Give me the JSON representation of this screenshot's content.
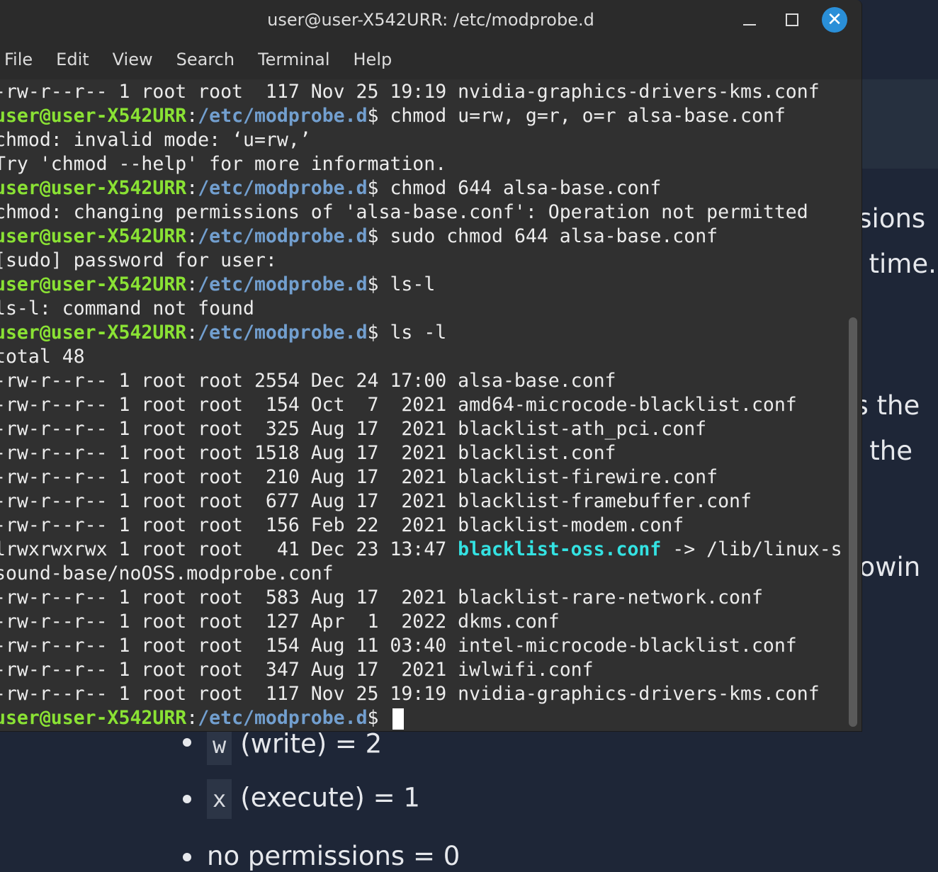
{
  "window": {
    "title": "user@user-X542URR: /etc/modprobe.d"
  },
  "menu": [
    "File",
    "Edit",
    "View",
    "Search",
    "Terminal",
    "Help"
  ],
  "prompt": {
    "user_host": "user@user-X542URR",
    "path": "/etc/modprobe.d",
    "symbol": "$ "
  },
  "terminal_lines": [
    "-rw-r--r-- 1 root root  117 Nov 25 19:19 nvidia-graphics-drivers-kms.conf",
    {
      "cmd": "chmod u=rw, g=r, o=r alsa-base.conf"
    },
    "chmod: invalid mode: ‘u=rw,’",
    "Try 'chmod --help' for more information.",
    {
      "cmd": "chmod 644 alsa-base.conf"
    },
    "chmod: changing permissions of 'alsa-base.conf': Operation not permitted",
    {
      "cmd": "sudo chmod 644 alsa-base.conf"
    },
    "[sudo] password for user:",
    {
      "cmd": "ls-l"
    },
    "ls-l: command not found",
    {
      "cmd": "ls -l"
    },
    "total 48",
    "-rw-r--r-- 1 root root 2554 Dec 24 17:00 alsa-base.conf",
    "-rw-r--r-- 1 root root  154 Oct  7  2021 amd64-microcode-blacklist.conf",
    "-rw-r--r-- 1 root root  325 Aug 17  2021 blacklist-ath_pci.conf",
    "-rw-r--r-- 1 root root 1518 Aug 17  2021 blacklist.conf",
    "-rw-r--r-- 1 root root  210 Aug 17  2021 blacklist-firewire.conf",
    "-rw-r--r-- 1 root root  677 Aug 17  2021 blacklist-framebuffer.conf",
    "-rw-r--r-- 1 root root  156 Feb 22  2021 blacklist-modem.conf",
    {
      "pre": "lrwxrwxrwx 1 root root   41 Dec 23 13:47 ",
      "link": "blacklist-oss.conf",
      "post": " -> /lib/linux-s"
    },
    "sound-base/noOSS.modprobe.conf",
    "-rw-r--r-- 1 root root  583 Aug 17  2021 blacklist-rare-network.conf",
    "-rw-r--r-- 1 root root  127 Apr  1  2022 dkms.conf",
    "-rw-r--r-- 1 root root  154 Aug 11 03:40 intel-microcode-blacklist.conf",
    "-rw-r--r-- 1 root root  347 Aug 17  2021 iwlwifi.conf",
    "-rw-r--r-- 1 root root  117 Nov 25 19:19 nvidia-graphics-drivers-kms.conf",
    {
      "cmd": "",
      "cursor": true
    }
  ],
  "background_page": {
    "fragments": [
      "ssions",
      "e time.",
      "ts the",
      "d the",
      "llowin"
    ],
    "list_items": [
      {
        "code": "w",
        "text": "(write) = 2"
      },
      {
        "code": "x",
        "text": "(execute) = 1"
      },
      {
        "code": "",
        "text": "no permissions = 0"
      }
    ]
  }
}
